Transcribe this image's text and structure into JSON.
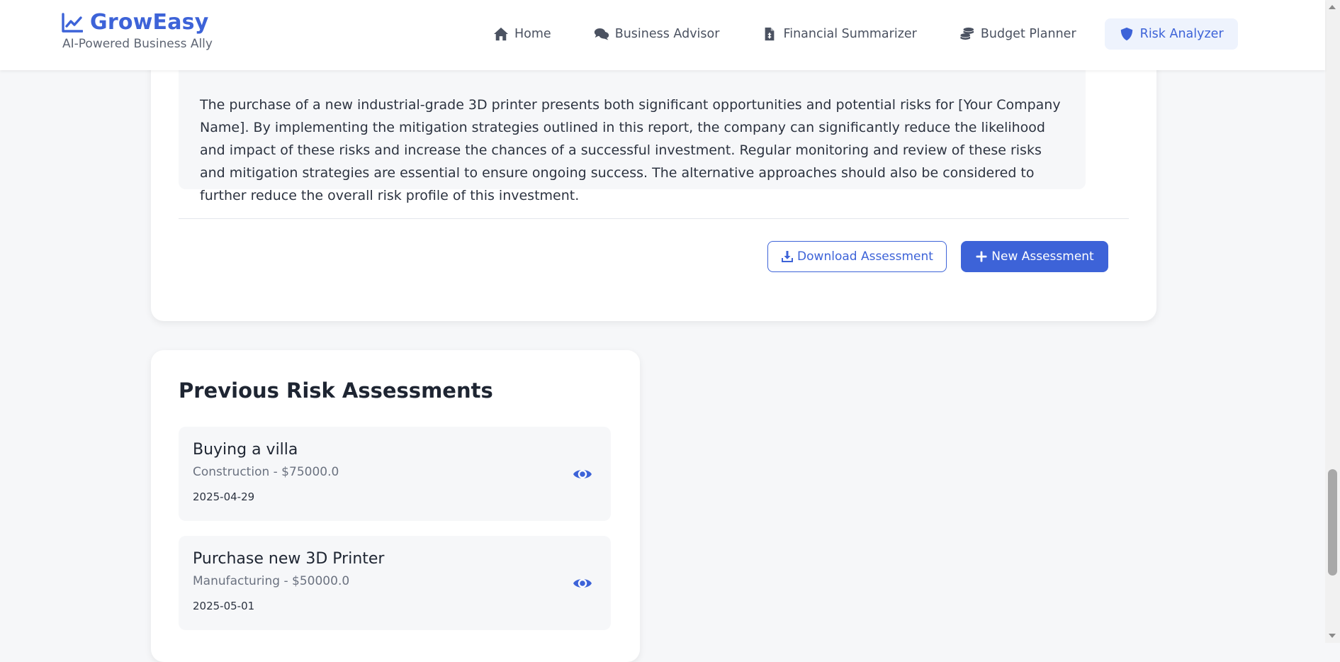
{
  "brand": {
    "name": "GrowEasy",
    "tagline": "AI-Powered Business Ally",
    "icon": "chart-line-icon",
    "accent_color": "#3d63d8"
  },
  "nav": {
    "items": [
      {
        "label": "Home",
        "icon": "home-icon",
        "active": false
      },
      {
        "label": "Business Advisor",
        "icon": "comments-icon",
        "active": false
      },
      {
        "label": "Financial Summarizer",
        "icon": "file-invoice-dollar-icon",
        "active": false
      },
      {
        "label": "Budget Planner",
        "icon": "coins-icon",
        "active": false
      },
      {
        "label": "Risk Analyzer",
        "icon": "shield-icon",
        "active": true
      }
    ]
  },
  "assessment": {
    "conclusion_text": "The purchase of a new industrial-grade 3D printer presents both significant opportunities and potential risks for [Your Company Name]. By implementing the mitigation strategies outlined in this report, the company can significantly reduce the likelihood and impact of these risks and increase the chances of a successful investment. Regular monitoring and review of these risks and mitigation strategies are essential to ensure ongoing success. The alternative approaches should also be considered to further reduce the overall risk profile of this investment.",
    "download_label": "Download Assessment",
    "download_icon": "download-icon",
    "new_label": "New Assessment",
    "new_icon": "plus-icon"
  },
  "previous": {
    "title": "Previous Risk Assessments",
    "items": [
      {
        "name": "Buying a villa",
        "meta": "Construction - $75000.0",
        "date": "2025-04-29",
        "action_icon": "eye-icon"
      },
      {
        "name": "Purchase new 3D Printer",
        "meta": "Manufacturing - $50000.0",
        "date": "2025-05-01",
        "action_icon": "eye-icon"
      }
    ]
  }
}
